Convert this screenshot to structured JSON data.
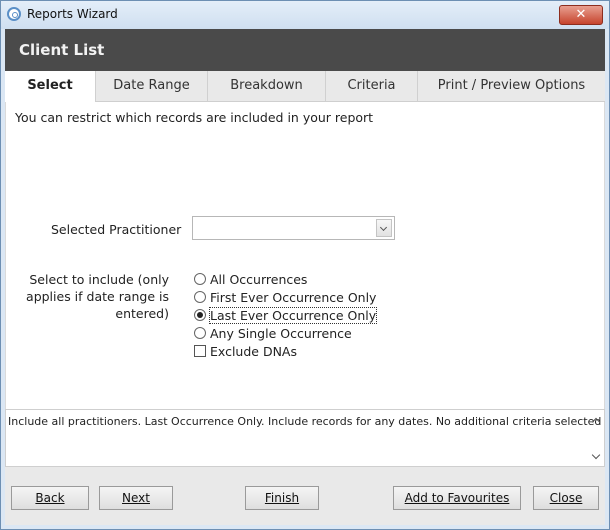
{
  "window": {
    "title": "Reports Wizard",
    "close_glyph": "✕"
  },
  "header": {
    "title": "Client List"
  },
  "tabs": [
    {
      "label": "Select"
    },
    {
      "label": "Date Range"
    },
    {
      "label": "Breakdown"
    },
    {
      "label": "Criteria"
    },
    {
      "label": "Print / Preview Options"
    }
  ],
  "select_tab": {
    "intro": "You can restrict which records are included in your report",
    "practitioner_label": "Selected Practitioner",
    "practitioner_value": "",
    "include_label_lines": [
      "Select to include   (only",
      "applies if date range is",
      "entered)"
    ],
    "include_options": [
      {
        "label": "All Occurrences",
        "checked": false
      },
      {
        "label": "First Ever Occurrence Only",
        "checked": false
      },
      {
        "label": "Last Ever Occurrence Only",
        "checked": true
      },
      {
        "label": "Any Single Occurrence",
        "checked": false
      }
    ],
    "exclude_dnas_label": "Exclude DNAs",
    "exclude_dnas_checked": false
  },
  "summary": "Include all practitioners. Last Occurrence Only. Include records for any dates. No additional criteria selected",
  "footer": {
    "back": "Back",
    "next": "Next",
    "finish": "Finish",
    "add_favourites": "Add to Favourites",
    "close": "Close"
  }
}
